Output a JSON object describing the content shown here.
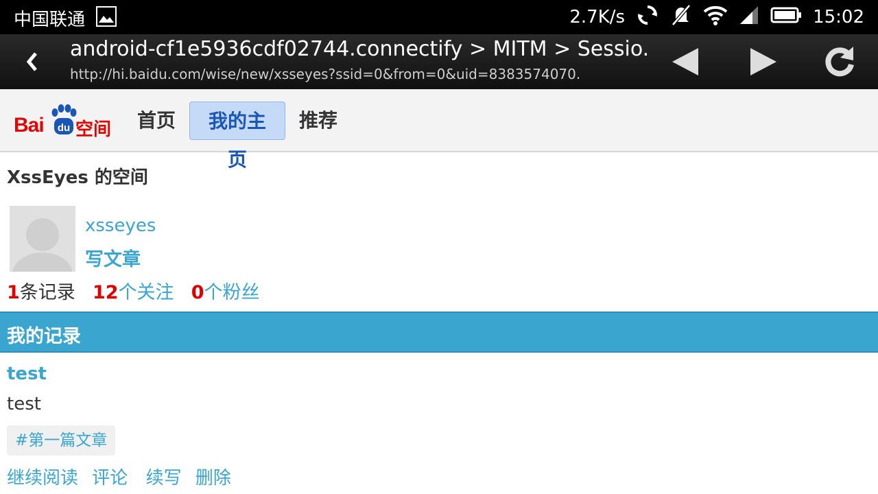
{
  "status_bar": {
    "carrier": "中国联通",
    "net_speed": "2.7K/s",
    "time": "15:02",
    "icons": [
      "image-icon",
      "sync-icon",
      "mute-icon",
      "wifi-icon",
      "signal-icon",
      "battery-icon"
    ]
  },
  "browser": {
    "title": "android-cf1e5936cdf02744.connectify > MITM > Sessio.",
    "url": "http://hi.baidu.com/wise/new/xsseyes?ssid=0&from=0&uid=8383574070."
  },
  "site": {
    "logo_bai": "Bai",
    "logo_du": "du",
    "logo_suffix": "空间",
    "nav": [
      {
        "label": "首页",
        "active": false
      },
      {
        "label": "我的主页",
        "active": true
      },
      {
        "label": "推荐",
        "active": false
      }
    ]
  },
  "profile": {
    "space_title": "XssEyes 的空间",
    "username": "xsseyes",
    "write_link": "写文章",
    "stats": {
      "records_num": "1",
      "records_label": "条记录",
      "following_num": "12",
      "following_label": "个关注",
      "fans_num": "0",
      "fans_label": "个粉丝"
    }
  },
  "records": {
    "header": "我的记录",
    "post": {
      "title": "test",
      "body": "test",
      "tag": "#第一篇文章",
      "actions": [
        "继续阅读",
        "评论",
        "续写",
        "删除"
      ]
    }
  },
  "colors": {
    "accent": "#3aa6cf",
    "brand_red": "#e10601",
    "number_red": "#e00000"
  }
}
